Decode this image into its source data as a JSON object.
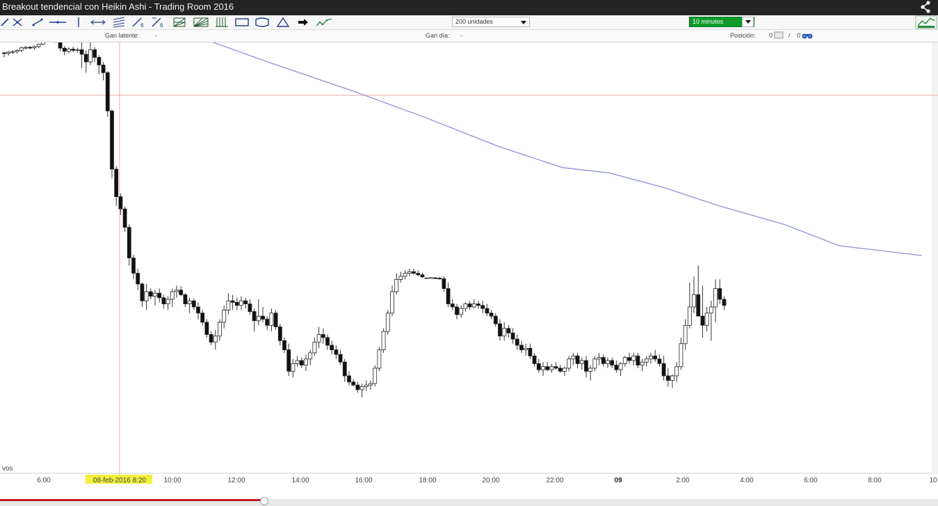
{
  "window": {
    "title": "Breakout tendencial con Heikin Ashi - Trading Room 2016"
  },
  "toolbar": {
    "tools": [
      "diagonal-line-tool",
      "node-line-tool",
      "segment-tool",
      "horizontal-line-tool",
      "vertical-line-tool",
      "ray-tool",
      "channel-tool",
      "angle-tool",
      "fibonacci-tool",
      "fibonacci-fan-tool",
      "gann-tool",
      "rectangle-tool",
      "ellipse-tool",
      "triangle-tool",
      "arrow-tool",
      "pattern-tool"
    ],
    "units_select": "200 unidades",
    "timeframe_select": "10 minutos"
  },
  "status": {
    "latent_label": "Gan latente:",
    "latent_value": "-",
    "day_label": "Gan día:",
    "day_value": "-",
    "position_label": "Posición:",
    "position_value_1": "0",
    "position_sep": "/",
    "position_value_2": "0"
  },
  "chart_data": {
    "type": "candlestick",
    "title": "",
    "volume_label": "vos",
    "x_ticks": [
      "6:00",
      "08-feb-2016 8:20",
      "10:00",
      "12:00",
      "14:00",
      "16:00",
      "18:00",
      "20:00",
      "22:00",
      "09",
      "2:00",
      "4:00",
      "6:00",
      "8:00",
      "10"
    ],
    "cursor_label": "08-feb-2016 8:20",
    "moving_average_color": "#8c8fd8",
    "bull_color": "#ffffff",
    "bear_color": "#111111",
    "candles": [
      [
        0.83,
        0.833,
        0.815,
        0.828
      ],
      [
        0.828,
        0.836,
        0.82,
        0.832
      ],
      [
        0.832,
        0.838,
        0.826,
        0.834
      ],
      [
        0.834,
        0.842,
        0.828,
        0.838
      ],
      [
        0.838,
        0.85,
        0.832,
        0.846
      ],
      [
        0.846,
        0.852,
        0.84,
        0.848
      ],
      [
        0.848,
        0.852,
        0.842,
        0.846
      ],
      [
        0.846,
        0.854,
        0.84,
        0.85
      ],
      [
        0.85,
        0.86,
        0.845,
        0.858
      ],
      [
        0.858,
        0.875,
        0.855,
        0.87
      ],
      [
        0.87,
        0.882,
        0.865,
        0.878
      ],
      [
        0.878,
        0.888,
        0.872,
        0.872
      ],
      [
        0.872,
        0.88,
        0.862,
        0.865
      ],
      [
        0.865,
        0.87,
        0.835,
        0.845
      ],
      [
        0.845,
        0.852,
        0.822,
        0.835
      ],
      [
        0.835,
        0.848,
        0.828,
        0.842
      ],
      [
        0.842,
        0.85,
        0.832,
        0.838
      ],
      [
        0.838,
        0.846,
        0.83,
        0.84
      ],
      [
        0.84,
        0.905,
        0.78,
        0.825
      ],
      [
        0.825,
        0.838,
        0.765,
        0.8
      ],
      [
        0.8,
        0.905,
        0.79,
        0.84
      ],
      [
        0.84,
        0.848,
        0.8,
        0.815
      ],
      [
        0.815,
        0.822,
        0.76,
        0.79
      ],
      [
        0.79,
        0.8,
        0.74,
        0.765
      ],
      [
        0.765,
        0.77,
        0.62,
        0.64
      ],
      [
        0.64,
        0.645,
        0.42,
        0.45
      ],
      [
        0.45,
        0.46,
        0.33,
        0.36
      ],
      [
        0.36,
        0.37,
        0.3,
        0.32
      ],
      [
        0.32,
        0.328,
        0.245,
        0.26
      ],
      [
        0.26,
        0.27,
        0.135,
        0.16
      ],
      [
        0.16,
        0.17,
        0.09,
        0.11
      ],
      [
        0.11,
        0.125,
        0.055,
        0.075
      ],
      [
        0.075,
        0.08,
        0.0,
        0.02
      ],
      [
        0.02,
        0.075,
        -0.01,
        0.05
      ],
      [
        0.05,
        0.06,
        0.025,
        0.035
      ],
      [
        0.035,
        0.055,
        0.005,
        0.045
      ],
      [
        0.045,
        0.06,
        0.015,
        0.03
      ],
      [
        0.03,
        0.04,
        -0.005,
        0.01
      ],
      [
        0.01,
        0.035,
        -0.01,
        0.025
      ],
      [
        0.025,
        0.06,
        0.0,
        0.05
      ],
      [
        0.05,
        0.07,
        0.03,
        0.055
      ],
      [
        0.055,
        0.068,
        0.035,
        0.04
      ],
      [
        0.04,
        0.045,
        0.0,
        0.01
      ],
      [
        0.01,
        0.03,
        -0.02,
        0.02
      ],
      [
        0.02,
        0.028,
        -0.01,
        0.0
      ],
      [
        0.0,
        0.015,
        -0.04,
        -0.02
      ],
      [
        -0.02,
        -0.01,
        -0.06,
        -0.05
      ],
      [
        -0.05,
        -0.04,
        -0.1,
        -0.09
      ],
      [
        -0.09,
        -0.08,
        -0.125,
        -0.115
      ],
      [
        -0.115,
        -0.075,
        -0.14,
        -0.095
      ],
      [
        -0.095,
        -0.04,
        -0.11,
        -0.05
      ],
      [
        -0.05,
        0.005,
        -0.07,
        -0.01
      ],
      [
        -0.01,
        0.045,
        -0.025,
        0.02
      ],
      [
        0.02,
        0.04,
        -0.01,
        0.015
      ],
      [
        0.015,
        0.03,
        -0.01,
        0.005
      ],
      [
        0.005,
        0.035,
        -0.01,
        0.02
      ],
      [
        0.02,
        0.03,
        -0.005,
        0.01
      ],
      [
        0.01,
        0.025,
        -0.025,
        -0.015
      ],
      [
        -0.015,
        -0.005,
        -0.08,
        -0.045
      ],
      [
        -0.045,
        0.025,
        -0.06,
        -0.03
      ],
      [
        -0.03,
        0.0,
        -0.05,
        -0.04
      ],
      [
        -0.04,
        -0.03,
        -0.075,
        -0.06
      ],
      [
        -0.06,
        -0.005,
        -0.08,
        -0.02
      ],
      [
        -0.02,
        -0.01,
        -0.075,
        -0.065
      ],
      [
        -0.065,
        -0.055,
        -0.125,
        -0.11
      ],
      [
        -0.11,
        -0.1,
        -0.15,
        -0.14
      ],
      [
        -0.14,
        -0.12,
        -0.225,
        -0.21
      ],
      [
        -0.21,
        -0.17,
        -0.23,
        -0.185
      ],
      [
        -0.185,
        -0.16,
        -0.195,
        -0.175
      ],
      [
        -0.175,
        -0.165,
        -0.2,
        -0.19
      ],
      [
        -0.19,
        -0.155,
        -0.21,
        -0.17
      ],
      [
        -0.17,
        -0.14,
        -0.19,
        -0.15
      ],
      [
        -0.15,
        -0.1,
        -0.16,
        -0.115
      ],
      [
        -0.115,
        -0.065,
        -0.135,
        -0.09
      ],
      [
        -0.09,
        -0.07,
        -0.12,
        -0.1
      ],
      [
        -0.1,
        -0.09,
        -0.14,
        -0.125
      ],
      [
        -0.125,
        -0.11,
        -0.155,
        -0.14
      ],
      [
        -0.14,
        -0.125,
        -0.17,
        -0.155
      ],
      [
        -0.155,
        -0.14,
        -0.19,
        -0.18
      ],
      [
        -0.18,
        -0.17,
        -0.245,
        -0.225
      ],
      [
        -0.225,
        -0.21,
        -0.255,
        -0.245
      ],
      [
        -0.245,
        -0.235,
        -0.26,
        -0.255
      ],
      [
        -0.255,
        -0.245,
        -0.28,
        -0.27
      ],
      [
        -0.27,
        -0.25,
        -0.295,
        -0.26
      ],
      [
        -0.26,
        -0.24,
        -0.275,
        -0.255
      ],
      [
        -0.255,
        -0.24,
        -0.27,
        -0.25
      ],
      [
        -0.25,
        -0.19,
        -0.26,
        -0.2
      ],
      [
        -0.2,
        -0.13,
        -0.21,
        -0.14
      ],
      [
        -0.14,
        -0.07,
        -0.15,
        -0.08
      ],
      [
        -0.08,
        -0.01,
        -0.09,
        -0.02
      ],
      [
        -0.02,
        0.07,
        -0.03,
        0.05
      ],
      [
        0.05,
        0.11,
        0.04,
        0.09
      ],
      [
        0.09,
        0.115,
        0.08,
        0.1
      ],
      [
        0.1,
        0.12,
        0.09,
        0.11
      ],
      [
        0.11,
        0.125,
        0.1,
        0.115
      ],
      [
        0.115,
        0.125,
        0.105,
        0.11
      ],
      [
        0.11,
        0.12,
        0.1,
        0.105
      ],
      [
        0.105,
        0.112,
        0.095,
        0.098
      ],
      [
        0.095,
        0.095,
        0.095,
        0.095
      ],
      [
        0.096,
        0.096,
        0.096,
        0.096
      ],
      [
        0.095,
        0.098,
        0.092,
        0.094
      ],
      [
        0.094,
        0.098,
        0.09,
        0.092
      ],
      [
        0.092,
        0.1,
        0.05,
        0.06
      ],
      [
        0.06,
        0.08,
        0.0,
        0.01
      ],
      [
        0.01,
        0.025,
        -0.01,
        0.0
      ],
      [
        0.0,
        0.01,
        -0.04,
        -0.025
      ],
      [
        -0.025,
        0.005,
        -0.035,
        -0.005
      ],
      [
        -0.005,
        0.015,
        -0.015,
        0.01
      ],
      [
        0.01,
        0.02,
        -0.01,
        0.0
      ],
      [
        0.0,
        0.025,
        -0.005,
        0.01
      ],
      [
        0.01,
        0.02,
        -0.005,
        0.005
      ],
      [
        0.005,
        0.02,
        -0.02,
        -0.005
      ],
      [
        -0.005,
        0.01,
        -0.03,
        -0.02
      ],
      [
        -0.02,
        -0.01,
        -0.04,
        -0.03
      ],
      [
        -0.03,
        -0.02,
        -0.065,
        -0.055
      ],
      [
        -0.055,
        -0.04,
        -0.11,
        -0.095
      ],
      [
        -0.095,
        -0.05,
        -0.11,
        -0.07
      ],
      [
        -0.07,
        -0.06,
        -0.1,
        -0.085
      ],
      [
        -0.085,
        -0.07,
        -0.12,
        -0.105
      ],
      [
        -0.105,
        -0.09,
        -0.14,
        -0.125
      ],
      [
        -0.125,
        -0.11,
        -0.15,
        -0.14
      ],
      [
        -0.14,
        -0.12,
        -0.16,
        -0.135
      ],
      [
        -0.135,
        -0.12,
        -0.17,
        -0.16
      ],
      [
        -0.16,
        -0.15,
        -0.195,
        -0.185
      ],
      [
        -0.185,
        -0.17,
        -0.215,
        -0.205
      ],
      [
        -0.205,
        -0.18,
        -0.225,
        -0.195
      ],
      [
        -0.195,
        -0.18,
        -0.21,
        -0.205
      ],
      [
        -0.205,
        -0.185,
        -0.215,
        -0.195
      ],
      [
        -0.195,
        -0.18,
        -0.205,
        -0.2
      ],
      [
        -0.2,
        -0.19,
        -0.215,
        -0.21
      ],
      [
        -0.21,
        -0.195,
        -0.225,
        -0.2
      ],
      [
        -0.2,
        -0.16,
        -0.21,
        -0.17
      ],
      [
        -0.17,
        -0.15,
        -0.19,
        -0.16
      ],
      [
        -0.16,
        -0.15,
        -0.2,
        -0.185
      ],
      [
        -0.185,
        -0.165,
        -0.205,
        -0.175
      ],
      [
        -0.175,
        -0.16,
        -0.23,
        -0.21
      ],
      [
        -0.21,
        -0.19,
        -0.24,
        -0.2
      ],
      [
        -0.2,
        -0.16,
        -0.21,
        -0.17
      ],
      [
        -0.17,
        -0.15,
        -0.19,
        -0.165
      ],
      [
        -0.165,
        -0.155,
        -0.195,
        -0.185
      ],
      [
        -0.185,
        -0.165,
        -0.2,
        -0.175
      ],
      [
        -0.175,
        -0.165,
        -0.2,
        -0.19
      ],
      [
        -0.19,
        -0.175,
        -0.215,
        -0.205
      ],
      [
        -0.205,
        -0.18,
        -0.225,
        -0.185
      ],
      [
        -0.185,
        -0.16,
        -0.195,
        -0.165
      ],
      [
        -0.165,
        -0.15,
        -0.185,
        -0.175
      ],
      [
        -0.175,
        -0.15,
        -0.19,
        -0.16
      ],
      [
        -0.16,
        -0.15,
        -0.2,
        -0.19
      ],
      [
        -0.19,
        -0.17,
        -0.21,
        -0.18
      ],
      [
        -0.18,
        -0.16,
        -0.195,
        -0.17
      ],
      [
        -0.17,
        -0.15,
        -0.185,
        -0.16
      ],
      [
        -0.16,
        -0.14,
        -0.18,
        -0.17
      ],
      [
        -0.17,
        -0.155,
        -0.195,
        -0.185
      ],
      [
        -0.185,
        -0.16,
        -0.24,
        -0.225
      ],
      [
        -0.225,
        -0.2,
        -0.26,
        -0.24
      ],
      [
        -0.24,
        -0.22,
        -0.265,
        -0.225
      ],
      [
        -0.225,
        -0.18,
        -0.245,
        -0.195
      ],
      [
        -0.195,
        -0.1,
        -0.205,
        -0.12
      ],
      [
        -0.12,
        -0.04,
        -0.14,
        -0.06
      ],
      [
        -0.06,
        0.08,
        -0.07,
        0.0
      ],
      [
        0.0,
        0.1,
        -0.02,
        0.04
      ],
      [
        0.04,
        0.135,
        0.02,
        -0.03
      ],
      [
        -0.03,
        0.07,
        -0.1,
        -0.06
      ],
      [
        -0.06,
        0.0,
        -0.08,
        -0.02
      ],
      [
        -0.02,
        0.02,
        -0.11,
        0.0
      ],
      [
        0.0,
        0.09,
        -0.05,
        0.06
      ],
      [
        0.06,
        0.09,
        0.01,
        0.025
      ],
      [
        0.025,
        0.035,
        -0.01,
        0.005
      ]
    ],
    "moving_average": [
      [
        0,
        0.92
      ],
      [
        0.06,
        0.912
      ],
      [
        0.14,
        0.902
      ],
      [
        0.22,
        0.876
      ],
      [
        0.3,
        0.79
      ],
      [
        0.38,
        0.708
      ],
      [
        0.46,
        0.62
      ],
      [
        0.54,
        0.525
      ],
      [
        0.61,
        0.455
      ],
      [
        0.66,
        0.438
      ],
      [
        0.72,
        0.39
      ],
      [
        0.78,
        0.33
      ],
      [
        0.85,
        0.27
      ],
      [
        0.91,
        0.2
      ],
      [
        1.0,
        0.168
      ]
    ]
  }
}
